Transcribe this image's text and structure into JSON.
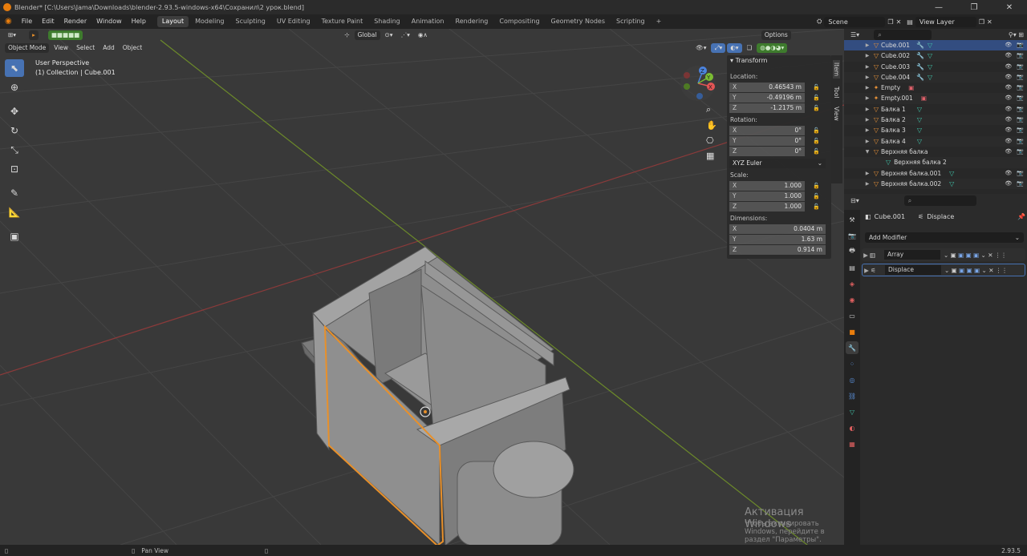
{
  "window": {
    "title": "Blender* [C:\\Users\\Jama\\Downloads\\blender-2.93.5-windows-x64\\Сохранил\\2 урок.blend]",
    "controls": [
      "—",
      "❐",
      "✕"
    ]
  },
  "menubar": {
    "items": [
      "File",
      "Edit",
      "Render",
      "Window",
      "Help"
    ],
    "workspaces": [
      "Layout",
      "Modeling",
      "Sculpting",
      "UV Editing",
      "Texture Paint",
      "Shading",
      "Animation",
      "Rendering",
      "Compositing",
      "Geometry Nodes",
      "Scripting"
    ],
    "active_workspace": "Layout",
    "add_tab": "+",
    "scene": "Scene",
    "view_layer": "View Layer"
  },
  "viewport": {
    "mode": "Object Mode",
    "menus": [
      "View",
      "Select",
      "Add",
      "Object"
    ],
    "orientation": "Global",
    "options": "Options",
    "overlay_text_1": "User Perspective",
    "overlay_text_2": "(1) Collection | Cube.001",
    "gizmo_labels": {
      "x": "X",
      "y": "Y",
      "z": "Z"
    },
    "watermark_title": "Активация Windows",
    "watermark_sub": "Чтобы активировать Windows, перейдите в раздел \"Параметры\"."
  },
  "npanel": {
    "section": "Transform",
    "location_label": "Location:",
    "location": [
      {
        "axis": "X",
        "value": "0.46543 m"
      },
      {
        "axis": "Y",
        "value": "-0.49196 m"
      },
      {
        "axis": "Z",
        "value": "-1.2175 m"
      }
    ],
    "rotation_label": "Rotation:",
    "rotation": [
      {
        "axis": "X",
        "value": "0°"
      },
      {
        "axis": "Y",
        "value": "0°"
      },
      {
        "axis": "Z",
        "value": "0°"
      }
    ],
    "rotation_mode": "XYZ Euler",
    "scale_label": "Scale:",
    "scale": [
      {
        "axis": "X",
        "value": "1.000"
      },
      {
        "axis": "Y",
        "value": "1.000"
      },
      {
        "axis": "Z",
        "value": "1.000"
      }
    ],
    "dimensions_label": "Dimensions:",
    "dimensions": [
      {
        "axis": "X",
        "value": "0.0404 m"
      },
      {
        "axis": "Y",
        "value": "1.63 m"
      },
      {
        "axis": "Z",
        "value": "0.914 m"
      }
    ],
    "tabs": [
      "Item",
      "Tool",
      "View"
    ]
  },
  "outliner": {
    "rows": [
      {
        "name": "Cube.001",
        "selected": true
      },
      {
        "name": "Cube.002"
      },
      {
        "name": "Cube.003"
      },
      {
        "name": "Cube.004"
      },
      {
        "name": "Empty"
      },
      {
        "name": "Empty.001"
      },
      {
        "name": "Балка 1"
      },
      {
        "name": "Балка 2"
      },
      {
        "name": "Балка 3"
      },
      {
        "name": "Балка 4"
      },
      {
        "name": "Верхняя балка"
      },
      {
        "name": "Верхняя балка 2"
      },
      {
        "name": "Верхняя балка.001"
      },
      {
        "name": "Верхняя балка.002"
      }
    ]
  },
  "properties": {
    "object": "Cube.001",
    "modifier_context": "Displace",
    "add_modifier": "Add Modifier",
    "modifiers": [
      "Array",
      "Displace"
    ]
  },
  "statusbar": {
    "pan": "Pan View",
    "version": "2.93.5"
  }
}
